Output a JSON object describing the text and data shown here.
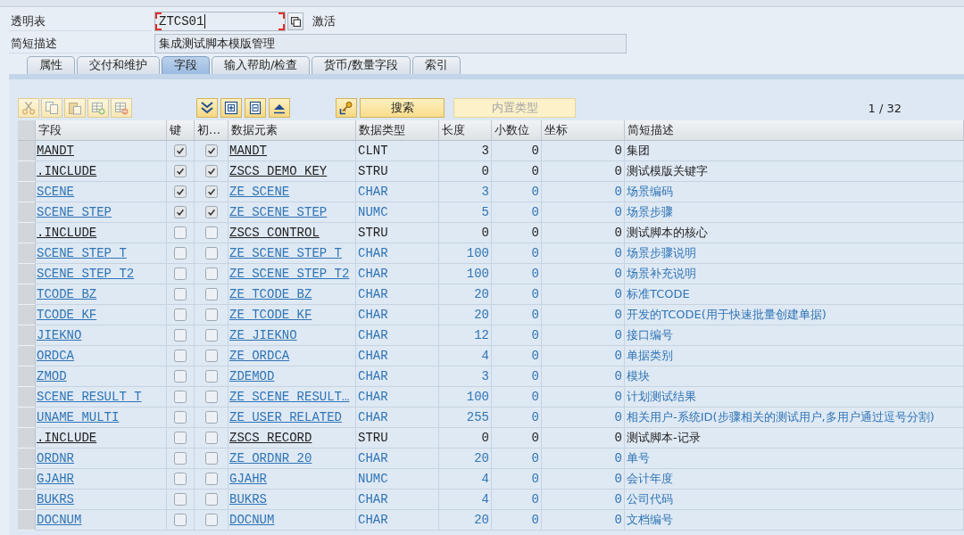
{
  "header": {
    "table_label": "透明表",
    "table_name": "ZTCS01",
    "status": "激活",
    "description_label": "简短描述",
    "description": "集成测试脚本模版管理"
  },
  "tabs": [
    {
      "label": "属性",
      "selected": false
    },
    {
      "label": "交付和维护",
      "selected": false
    },
    {
      "label": "字段",
      "selected": true
    },
    {
      "label": "输入帮助/检查",
      "selected": false
    },
    {
      "label": "货币/数量字段",
      "selected": false
    },
    {
      "label": "索引",
      "selected": false
    }
  ],
  "toolbar": {
    "icon_groups": [
      [
        {
          "disabled": true
        },
        {
          "disabled": true
        },
        {
          "disabled": true
        },
        {
          "disabled": true
        },
        {
          "disabled": true
        }
      ],
      [
        {
          "disabled": false
        },
        {
          "disabled": false
        },
        {
          "disabled": false
        },
        {
          "disabled": false
        }
      ],
      [
        {
          "disabled": false
        }
      ]
    ],
    "buttons": [
      {
        "label": "搜索",
        "disabled": false
      },
      {
        "label": "内置类型",
        "disabled": true
      }
    ],
    "page_counter": "1 / 32"
  },
  "table": {
    "columns": [
      "字段",
      "键",
      "初…",
      "数据元素",
      "数据类型",
      "长度",
      "小数位",
      "坐标",
      "简短描述"
    ],
    "rows": [
      {
        "kind": "standard",
        "field": "MANDT",
        "key": true,
        "initial": true,
        "data_element": "MANDT",
        "data_type": "CLNT",
        "length": "3",
        "decimals": "0",
        "coordinate": "0",
        "description": "集团"
      },
      {
        "kind": "standard",
        "field": ".INCLUDE",
        "key": true,
        "initial": true,
        "data_element": "ZSCS_DEMO_KEY",
        "data_type": "STRU",
        "length": "0",
        "decimals": "0",
        "coordinate": "0",
        "description": "测试模版关键字"
      },
      {
        "kind": "custom",
        "field": "SCENE",
        "key": true,
        "initial": true,
        "data_element": "ZE_SCENE",
        "data_type": "CHAR",
        "length": "3",
        "decimals": "0",
        "coordinate": "0",
        "description": "场景编码"
      },
      {
        "kind": "custom",
        "field": "SCENE_STEP",
        "key": true,
        "initial": true,
        "data_element": "ZE_SCENE_STEP",
        "data_type": "NUMC",
        "length": "5",
        "decimals": "0",
        "coordinate": "0",
        "description": "场景步骤"
      },
      {
        "kind": "standard",
        "field": ".INCLUDE",
        "key": false,
        "initial": false,
        "data_element": "ZSCS_CONTROL",
        "data_type": "STRU",
        "length": "0",
        "decimals": "0",
        "coordinate": "0",
        "description": "测试脚本的核心"
      },
      {
        "kind": "custom",
        "field": "SCENE_STEP_T",
        "key": false,
        "initial": false,
        "data_element": "ZE_SCENE_STEP_T",
        "data_type": "CHAR",
        "length": "100",
        "decimals": "0",
        "coordinate": "0",
        "description": "场景步骤说明"
      },
      {
        "kind": "custom",
        "field": "SCENE_STEP_T2",
        "key": false,
        "initial": false,
        "data_element": "ZE_SCENE_STEP_T2",
        "data_type": "CHAR",
        "length": "100",
        "decimals": "0",
        "coordinate": "0",
        "description": "场景补充说明"
      },
      {
        "kind": "custom",
        "field": "TCODE_BZ",
        "key": false,
        "initial": false,
        "data_element": "ZE_TCODE_BZ",
        "data_type": "CHAR",
        "length": "20",
        "decimals": "0",
        "coordinate": "0",
        "description": "标准TCODE"
      },
      {
        "kind": "custom",
        "field": "TCODE_KF",
        "key": false,
        "initial": false,
        "data_element": "ZE_TCODE_KF",
        "data_type": "CHAR",
        "length": "20",
        "decimals": "0",
        "coordinate": "0",
        "description": "开发的TCODE(用于快速批量创建单据)"
      },
      {
        "kind": "custom",
        "field": "JIEKNO",
        "key": false,
        "initial": false,
        "data_element": "ZE_JIEKNO",
        "data_type": "CHAR",
        "length": "12",
        "decimals": "0",
        "coordinate": "0",
        "description": "接口编号"
      },
      {
        "kind": "custom",
        "field": "ORDCA",
        "key": false,
        "initial": false,
        "data_element": "ZE_ORDCA",
        "data_type": "CHAR",
        "length": "4",
        "decimals": "0",
        "coordinate": "0",
        "description": "单据类别"
      },
      {
        "kind": "custom",
        "field": "ZMOD",
        "key": false,
        "initial": false,
        "data_element": "ZDEMOD",
        "data_type": "CHAR",
        "length": "3",
        "decimals": "0",
        "coordinate": "0",
        "description": "模块"
      },
      {
        "kind": "custom",
        "field": "SCENE_RESULT_T",
        "key": false,
        "initial": false,
        "data_element": "ZE_SCENE_RESULT…",
        "data_type": "CHAR",
        "length": "100",
        "decimals": "0",
        "coordinate": "0",
        "description": "计划测试结果"
      },
      {
        "kind": "custom",
        "field": "UNAME_MULTI",
        "key": false,
        "initial": false,
        "data_element": "ZE_USER_RELATED",
        "data_type": "CHAR",
        "length": "255",
        "decimals": "0",
        "coordinate": "0",
        "description": "相关用户-系统ID(步骤相关的测试用户,多用户通过逗号分割)"
      },
      {
        "kind": "standard",
        "field": ".INCLUDE",
        "key": false,
        "initial": false,
        "data_element": "ZSCS_RECORD",
        "data_type": "STRU",
        "length": "0",
        "decimals": "0",
        "coordinate": "0",
        "description": "测试脚本-记录"
      },
      {
        "kind": "custom",
        "field": "ORDNR",
        "key": false,
        "initial": false,
        "data_element": "ZE_ORDNR_20",
        "data_type": "CHAR",
        "length": "20",
        "decimals": "0",
        "coordinate": "0",
        "description": "单号"
      },
      {
        "kind": "custom",
        "field": "GJAHR",
        "key": false,
        "initial": false,
        "data_element": "GJAHR",
        "data_type": "NUMC",
        "length": "4",
        "decimals": "0",
        "coordinate": "0",
        "description": "会计年度"
      },
      {
        "kind": "custom",
        "field": "BUKRS",
        "key": false,
        "initial": false,
        "data_element": "BUKRS",
        "data_type": "CHAR",
        "length": "4",
        "decimals": "0",
        "coordinate": "0",
        "description": "公司代码"
      },
      {
        "kind": "custom",
        "field": "DOCNUM",
        "key": false,
        "initial": false,
        "data_element": "DOCNUM",
        "data_type": "CHAR",
        "length": "20",
        "decimals": "0",
        "coordinate": "0",
        "description": "文档编号"
      }
    ]
  }
}
